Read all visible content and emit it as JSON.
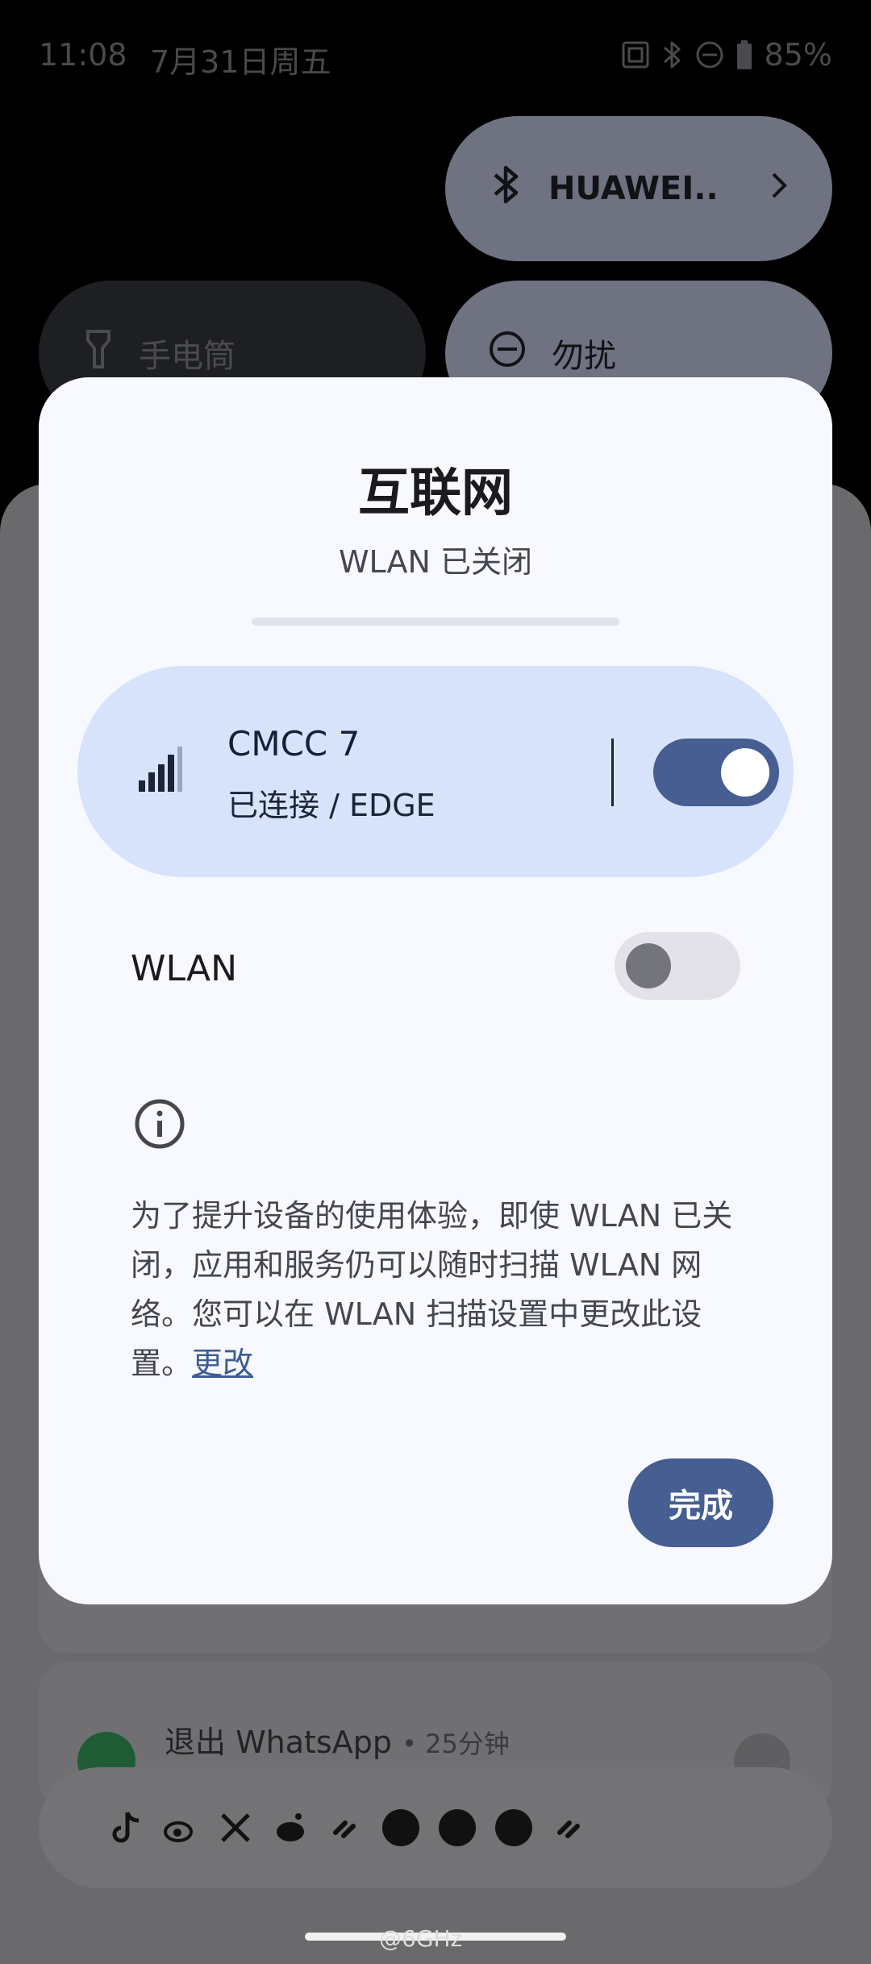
{
  "status_bar": {
    "time": "11:08",
    "date": "7月31日周五",
    "battery": "85%"
  },
  "quick_settings": {
    "bluetooth_label": "HUAWEI..",
    "flashlight_label": "手电筒",
    "dnd_label": "勿扰"
  },
  "dialog": {
    "title": "互联网",
    "subtitle": "WLAN 已关闭",
    "network": {
      "name": "CMCC 7",
      "status": "已连接 / EDGE",
      "enabled": true
    },
    "wlan": {
      "label": "WLAN",
      "enabled": false
    },
    "info_text": "为了提升设备的使用体验，即使 WLAN 已关闭，应用和服务仍可以随时扫描 WLAN 网络。您可以在 WLAN 扫描设置中更改此设置。",
    "info_link": "更改",
    "done_label": "完成"
  },
  "notification": {
    "title": "退出 WhatsApp",
    "time": "25分钟"
  },
  "watermark": "@6GHz",
  "colors": {
    "accent": "#465e91",
    "card_bg": "#d7e3fa",
    "dialog_bg": "#f8f9fe"
  }
}
